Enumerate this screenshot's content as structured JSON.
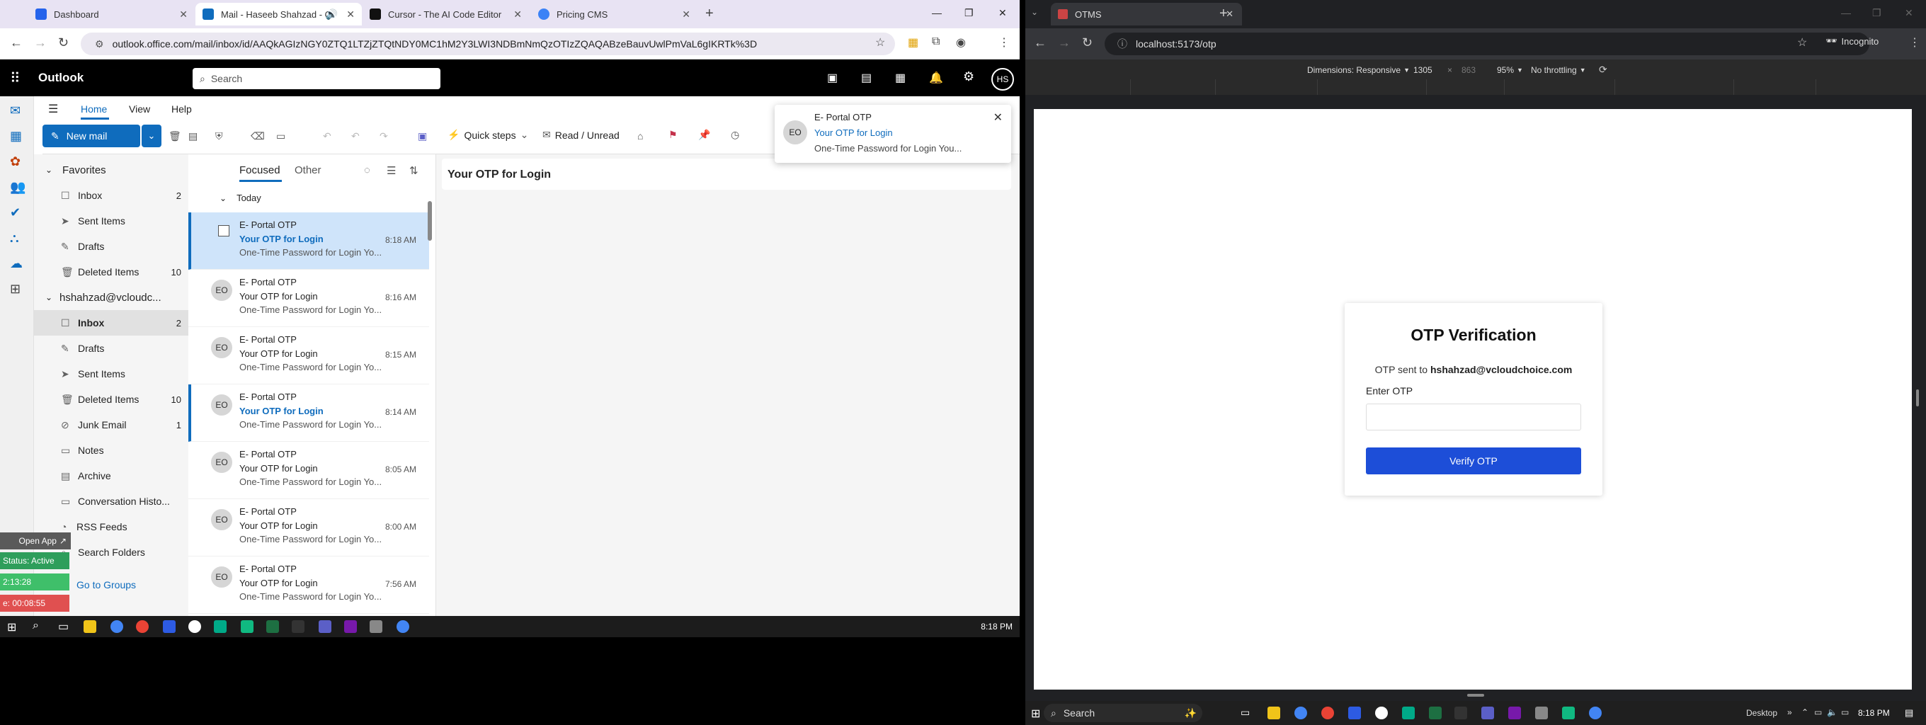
{
  "left_browser": {
    "tabs": [
      {
        "label": "Dashboard",
        "color": "#2563eb"
      },
      {
        "label": "Mail - Haseeb Shahzad - O",
        "color": "#0f6cbd"
      },
      {
        "label": "Cursor - The AI Code Editor",
        "color": "#111111"
      },
      {
        "label": "Pricing CMS",
        "color": "#3b82f6"
      }
    ],
    "new_tab": "+",
    "url": "outlook.office.com/mail/inbox/id/AAQkAGIzNGY0ZTQ1LTZjZTQtNDY0MC1hM2Y3LWI3NDBmNmQzOTIzZQAQABzeBauvUwlPmVaL6gIKRTk%3D",
    "win_controls": [
      "—",
      "❐",
      "✕"
    ]
  },
  "outlook": {
    "app_name": "Outlook",
    "search_placeholder": "Search",
    "avatar": "HS",
    "ribbon_tabs": [
      "Home",
      "View",
      "Help"
    ],
    "new_mail": "New mail",
    "quick_steps": "Quick steps",
    "read_unread": "Read / Unread",
    "favorites_header": "Favorites",
    "favorites": [
      {
        "label": "Inbox",
        "count": "2"
      },
      {
        "label": "Sent Items",
        "count": ""
      },
      {
        "label": "Drafts",
        "count": ""
      },
      {
        "label": "Deleted Items",
        "count": "10"
      }
    ],
    "account": "hshahzad@vcloudc...",
    "account_folders": [
      {
        "label": "Inbox",
        "count": "2"
      },
      {
        "label": "Drafts",
        "count": ""
      },
      {
        "label": "Sent Items",
        "count": ""
      },
      {
        "label": "Deleted Items",
        "count": "10"
      },
      {
        "label": "Junk Email",
        "count": "1"
      },
      {
        "label": "Notes",
        "count": ""
      },
      {
        "label": "Archive",
        "count": ""
      },
      {
        "label": "Conversation Histo...",
        "count": ""
      },
      {
        "label": "RSS Feeds",
        "count": ""
      },
      {
        "label": "Search Folders",
        "count": ""
      }
    ],
    "go_to_groups": "Go to Groups",
    "list_tabs": {
      "focused": "Focused",
      "other": "Other"
    },
    "group_header": "Today",
    "messages": [
      {
        "sender": "E- Portal OTP",
        "subject": "Your OTP for Login",
        "time": "8:18 AM",
        "preview": "One-Time Password for Login Yo...",
        "state": "selected"
      },
      {
        "sender": "E- Portal OTP",
        "subject": "Your OTP for Login",
        "time": "8:16 AM",
        "preview": "One-Time Password for Login Yo...",
        "state": "read"
      },
      {
        "sender": "E- Portal OTP",
        "subject": "Your OTP for Login",
        "time": "8:15 AM",
        "preview": "One-Time Password for Login Yo...",
        "state": "read"
      },
      {
        "sender": "E- Portal OTP",
        "subject": "Your OTP for Login",
        "time": "8:14 AM",
        "preview": "One-Time Password for Login Yo...",
        "state": "unread"
      },
      {
        "sender": "E- Portal OTP",
        "subject": "Your OTP for Login",
        "time": "8:05 AM",
        "preview": "One-Time Password for Login Yo...",
        "state": "read"
      },
      {
        "sender": "E- Portal OTP",
        "subject": "Your OTP for Login",
        "time": "8:00 AM",
        "preview": "One-Time Password for Login Yo...",
        "state": "read"
      },
      {
        "sender": "E- Portal OTP",
        "subject": "Your OTP for Login",
        "time": "7:56 AM",
        "preview": "One-Time Password for Login Yo...",
        "state": "read"
      }
    ],
    "avatar_initials": "EO",
    "reading_subject": "Your OTP for Login",
    "toast": {
      "sender": "E- Portal OTP",
      "subject": "Your OTP for Login",
      "preview": "One-Time Password for Login You..."
    }
  },
  "widget": {
    "open_app": "Open App",
    "status": "Status: Active",
    "timer1": "2:13:28",
    "timer2": "e: 00:08:55"
  },
  "left_taskbar": {
    "time": "8:18 PM"
  },
  "right_browser": {
    "tab": "OTMS",
    "new_tab": "+",
    "url": "localhost:5173/otp",
    "incognito": "Incognito",
    "devtools": {
      "dims_label": "Dimensions: Responsive",
      "width": "1305",
      "x": "×",
      "height": "863",
      "zoom": "95%",
      "throttle": "No throttling"
    }
  },
  "otp_card": {
    "title": "OTP Verification",
    "sent_prefix": "OTP sent to",
    "email": "hshahzad@vcloudchoice.com",
    "label": "Enter OTP",
    "input_value": "",
    "button": "Verify OTP",
    "button_color": "#1d4ed8"
  },
  "right_taskbar": {
    "search": "Search",
    "desktop": "Desktop",
    "time": "8:18 PM"
  }
}
